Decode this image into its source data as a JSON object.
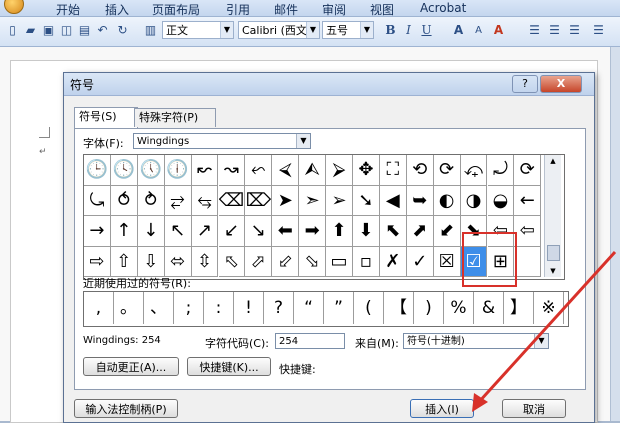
{
  "ribbon": {
    "tabs": [
      "开始",
      "插入",
      "页面布局",
      "引用",
      "邮件",
      "审阅",
      "视图",
      "Acrobat"
    ]
  },
  "toolbar": {
    "style_combo": "正文",
    "font_combo": "Calibri (西文)",
    "size_combo": "五号",
    "bold": "B",
    "italic": "I",
    "underline": "U",
    "grow_font": "A",
    "shrink_font": "A",
    "clear_format": "A"
  },
  "dialog": {
    "title": "符号",
    "help_button": "?",
    "close_button": "X",
    "tabs": [
      "符号(S)",
      "特殊字符(P)"
    ],
    "font_label": "字体(F):",
    "font_value": "Wingdings",
    "grid_rows": [
      [
        "🕒",
        "🕓",
        "🕔",
        "🕕",
        "↜",
        "↝",
        "⬿",
        "⮘",
        "⮙",
        "⮚",
        "✥",
        "⛶",
        "⟲",
        "⟳",
        "⤽",
        "⤾",
        "⟳"
      ],
      [
        "⤿",
        "⥀",
        "⥁",
        "⥂",
        "⥃",
        "⌫",
        "⌦",
        "➤",
        "➣",
        "➢",
        "➘",
        "◀",
        "➥",
        "◐",
        "◑",
        "◒",
        "←"
      ],
      [
        "→",
        "↑",
        "↓",
        "↖",
        "↗",
        "↙",
        "↘",
        "⬅",
        "➡",
        "⬆",
        "⬇",
        "⬉",
        "⬈",
        "⬋",
        "⬊",
        "⇦",
        "⇦"
      ],
      [
        "⇨",
        "⇧",
        "⇩",
        "⬄",
        "⇳",
        "⬁",
        "⬀",
        "⬃",
        "⬂",
        "▭",
        "▫",
        "✗",
        "✓",
        "☒",
        "☑",
        "⊞",
        ""
      ]
    ],
    "recent_label": "近期使用过的符号(R):",
    "recent_symbols": [
      ",",
      "。",
      "、",
      ";",
      ":",
      "!",
      "?",
      "“",
      "”",
      "(",
      "【",
      ")",
      "%",
      "&",
      "】",
      "※"
    ],
    "char_name": "Wingdings: 254",
    "char_code_label": "字符代码(C):",
    "char_code_value": "254",
    "from_label": "来自(M):",
    "from_value": "符号(十进制)",
    "autocorrect_button": "自动更正(A)...",
    "shortcut_button": "快捷键(K)...",
    "shortcut_label": "快捷键:",
    "ime_button": "输入法控制柄(P)",
    "insert_button": "插入(I)",
    "cancel_button": "取消"
  },
  "colors": {
    "accent": "#3e8ee9",
    "annotation": "#d8312a"
  }
}
